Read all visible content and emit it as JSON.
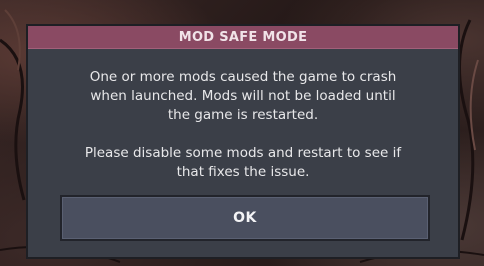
{
  "dialog": {
    "title": "MOD SAFE MODE",
    "message_1": "One or more mods caused the game to crash\nwhen launched. Mods will not be loaded until\nthe game is restarted.",
    "message_2": "Please disable some mods and restart to see if\nthat fixes the issue.",
    "ok_label": "OK"
  },
  "colors": {
    "header": "#8a4a63",
    "panel": "#3b3f48",
    "button": "#4a4f5f",
    "text": "#e8e8ea"
  }
}
